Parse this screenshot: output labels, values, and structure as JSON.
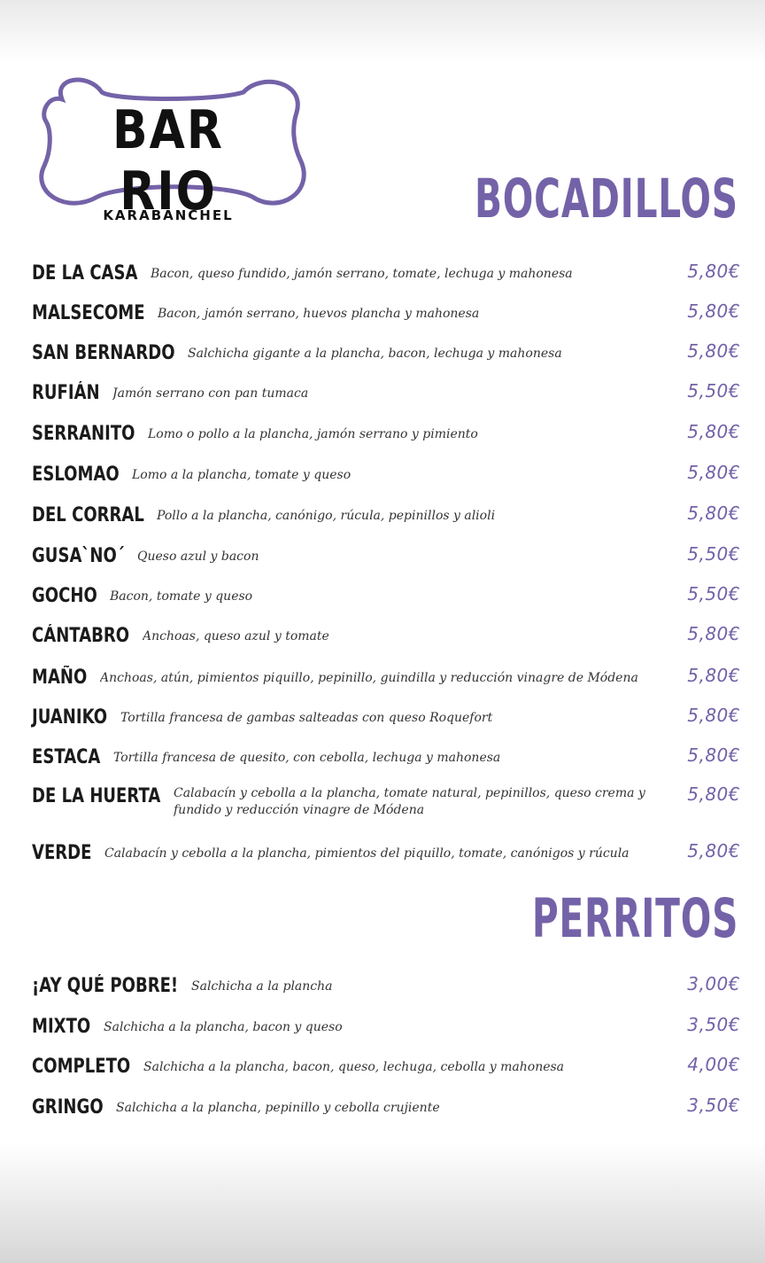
{
  "brand": {
    "name": "BAR RIO",
    "location": "KARABANCHEL",
    "accent": "#7462a8"
  },
  "bocadillos": {
    "title": "BOCADILLOS",
    "items": [
      {
        "name": "DE LA CASA",
        "desc": "Bacon, queso fundido, jamón serrano, tomate, lechuga y mahonesa",
        "price": "5,80€"
      },
      {
        "name": "MALSECOME",
        "desc": "Bacon,  jamón serrano, huevos plancha y mahonesa",
        "price": "5,80€"
      },
      {
        "name": "SAN BERNARDO",
        "desc": "Salchicha gigante a la plancha, bacon, lechuga y mahonesa",
        "price": "5,80€"
      },
      {
        "name": "RUFIÁN",
        "desc": "Jamón serrano con pan tumaca",
        "price": "5,50€"
      },
      {
        "name": "SERRANITO",
        "desc": "Lomo o pollo a la plancha, jamón serrano y pimiento",
        "price": "5,80€"
      },
      {
        "name": "ESLOMAO",
        "desc": "Lomo a la plancha, tomate y queso",
        "price": "5,80€"
      },
      {
        "name": "DEL CORRAL",
        "desc": "Pollo a la plancha, canónigo, rúcula, pepinillos y alioli",
        "price": "5,80€"
      },
      {
        "name": "GUSA`NO´",
        "desc": "Queso azul y bacon",
        "price": "5,50€"
      },
      {
        "name": "GOCHO",
        "desc": "Bacon, tomate y queso",
        "price": "5,50€"
      },
      {
        "name": "CÁNTABRO",
        "desc": "Anchoas, queso azul y tomate",
        "price": "5,80€"
      },
      {
        "name": "MAÑO",
        "desc": "Anchoas, atún, pimientos piquillo, pepinillo, guindilla y reducción vinagre de Módena",
        "price": "5,80€"
      },
      {
        "name": "JUANIKO",
        "desc": "Tortilla francesa de gambas salteadas con queso Roquefort",
        "price": "5,80€"
      },
      {
        "name": "ESTACA",
        "desc": "Tortilla francesa  de  quesito,  con  cebolla, lechuga y mahonesa",
        "price": "5,80€"
      },
      {
        "name": "DE LA HUERTA",
        "desc": "Calabacín y cebolla a la plancha, tomate natural, pepinillos, queso crema y fundido y reducción vinagre de Módena",
        "price": "5,80€"
      },
      {
        "name": "VERDE",
        "desc": "Calabacín y cebolla a la plancha, pimientos del piquillo, tomate, canónigos y rúcula",
        "price": "5,80€"
      }
    ]
  },
  "perritos": {
    "title": "PERRITOS",
    "items": [
      {
        "name": "¡AY QUÉ POBRE!",
        "desc": "Salchicha a la plancha",
        "price": "3,00€"
      },
      {
        "name": "MIXTO",
        "desc": "Salchicha a la plancha, bacon y queso",
        "price": "3,50€"
      },
      {
        "name": "COMPLETO",
        "desc": "Salchicha a la plancha, bacon, queso, lechuga, cebolla y mahonesa",
        "price": "4,00€"
      },
      {
        "name": "GRINGO",
        "desc": "Salchicha a la plancha, pepinillo   y   cebolla crujiente",
        "price": "3,50€"
      }
    ]
  }
}
